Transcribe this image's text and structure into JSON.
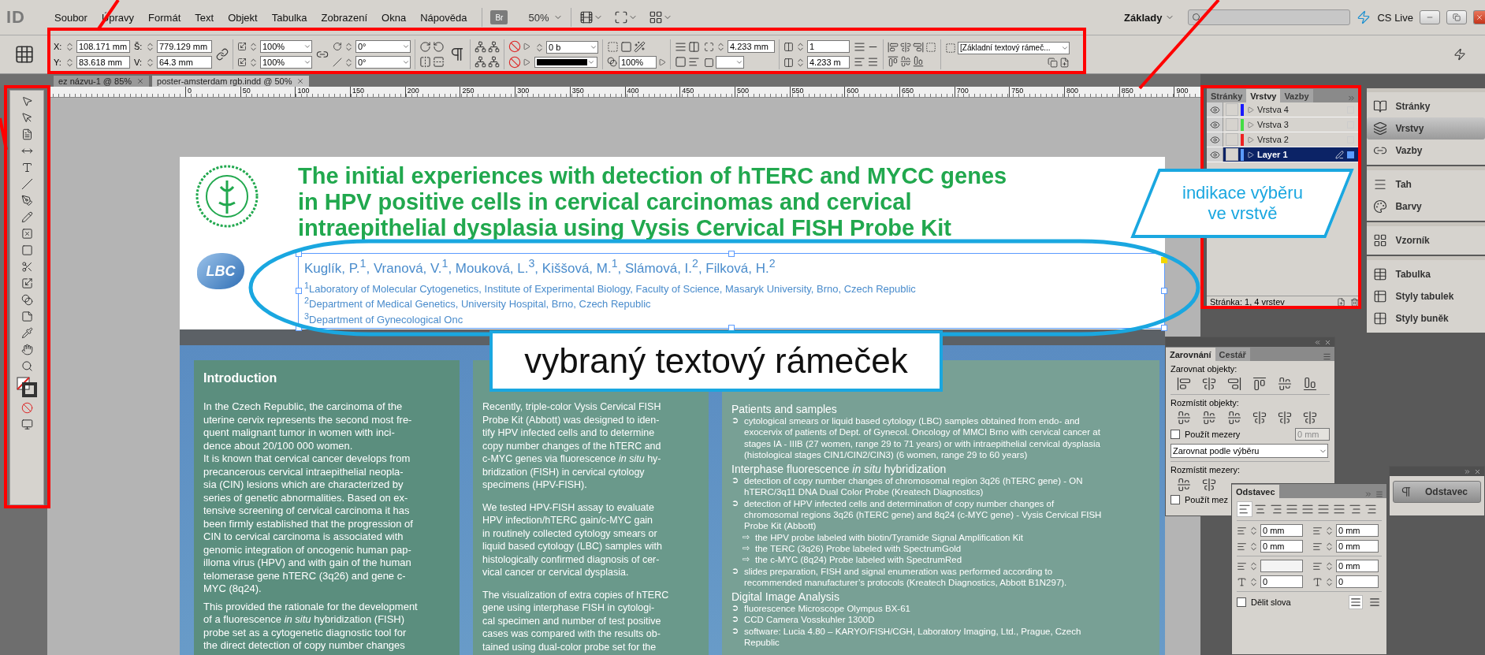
{
  "menu_bar": {
    "app_logo": "ID",
    "items": [
      "Soubor",
      "Úpravy",
      "Formát",
      "Text",
      "Objekt",
      "Tabulka",
      "Zobrazení",
      "Okna",
      "Nápověda"
    ],
    "bridge_button": "Br",
    "zoom": "50%",
    "workspace": "Základy",
    "cs_live": "CS Live"
  },
  "control_panel": {
    "position_fields": [
      {
        "label": "X:",
        "value": "108.171 mm"
      },
      {
        "label": "Y:",
        "value": "83.618 mm"
      }
    ],
    "size_fields": [
      {
        "label": "Š:",
        "value": "779.129 mm"
      },
      {
        "label": "V:",
        "value": "64.3 mm"
      }
    ],
    "scale": [
      "100%",
      "100%"
    ],
    "angles": [
      "0°",
      "0°"
    ],
    "stroke_weight": "0 b",
    "opacity": "100%",
    "inset": "4.233 mm",
    "columns": "1",
    "gutter": "4.233 m",
    "object_style": "[Základní textový rámeč..."
  },
  "document_tabs": [
    {
      "label": "ez názvu-1 @ 85%",
      "selected": false
    },
    {
      "label": "poster-amsterdam rgb.indd @ 50%",
      "selected": true
    }
  ],
  "ruler": [
    "0",
    "50",
    "100",
    "150",
    "200",
    "250",
    "300",
    "350",
    "400",
    "450",
    "500",
    "550",
    "600",
    "650",
    "700",
    "750",
    "800",
    "850",
    "900"
  ],
  "poster": {
    "logo_text": "LBC",
    "title": "The initial experiences with detection of hTERC and MYCC genes\nin HPV positive cells in cervical carcinomas and cervical\nintraepithelial dysplasia using Vysis Cervical FISH Probe Kit",
    "authors": "Kuglík, P.$^{1}$, Vranová, V.$^{1}$, Mouková, L.$^{3}$, Kiššová, M.$^{1}$, Slámová, I.$^{2}$, Filková, H.$^{2}$",
    "affiliations": [
      "$^{1}$Laboratory of Molecular Cytogenetics, Institute of Experimental Biology, Faculty of Science, Masaryk University, Brno, Czech Republic",
      "$^{2}$Department of Medical Genetics, University Hospital, Brno, Czech Republic",
      "$^{3}$Department of Gynecological Onc"
    ],
    "introduction": {
      "heading": "Introduction",
      "paragraphs": [
        "In the Czech Republic, the carcinoma of the\nuterine cervix represents the second most fre-\nquent malignant tumor in women with inci-\ndence about 20/100 000 women.\nIt is known that cervical cancer develops from\nprecancerous cervical intraepithelial neopla-\nsia (CIN) lesions which are characterized by\nseries of genetic abnormalities. Based on ex-\ntensive screening of cervical carcinoma it has\nbeen firmly established that the progression of\nCIN to cervical carcinoma is associated with\ngenomic integration of oncogenic human pap-\nilloma virus (HPV) and with gain of the human\ntelomerase gene hTERC (3q26) and gene c-\nMYC (8q24).",
        "This provided the rationale for the development\nof a fluorescence *in situ* hybridization (FISH)\nprobe set as a cytogenetic diagnostic tool for\nthe direct detection of copy number changes"
      ]
    },
    "aims": {
      "paragraphs": [
        "Recently, triple-color Vysis Cervical FISH\nProbe Kit (Abbott) was designed to iden-\ntify HPV infected cells and to determine\ncopy number changes of the hTERC and\nc-MYC genes via fluorescence *in situ* hy-\nbridization (FISH) in cervical cytology\nspecimens (HPV-FISH).",
        "We tested HPV-FISH assay to evaluate\nHPV infection/hTERC gain/c-MYC gain\nin routinely collected cytology smears or\nliquid based cytology (LBC) samples with\nhistologically confirmed diagnosis of cer-\nvical cancer or cervical dysplasia.",
        "The visualization of extra copies of hTERC\ngene using interphase FISH in cytologi-\ncal specimen and number of test positive\ncases was compared with the results ob-\ntained using dual-color probe set for the"
      ]
    },
    "methods": {
      "sections": [
        {
          "title": "Patients and samples",
          "items": [
            {
              "kind": "main",
              "marker": "➲",
              "text": "cytological smears or liquid based cytology (LBC) samples obtained from endo- and\nexocervix of patients of Dept. of Gynecol. Oncology of MMCI Brno with cervical cancer at\nstages IA - IIIB (27 women, range 29 to 71 years) or with intraepithelial cervical dysplasia\n(histological stages CIN1/CIN2/CIN3) (6 women, range 29 to 60 years)"
            }
          ]
        },
        {
          "title": "Interphase fluorescence *in situ* hybridization",
          "items": [
            {
              "kind": "main",
              "marker": "➲",
              "text": "detection of copy number changes of chromosomal region 3q26 (hTERC gene) - ON\nhTERC/3q11 DNA Dual Color Probe (Kreatech Diagnostics)"
            },
            {
              "kind": "main",
              "marker": "➲",
              "text": "detection of HPV infected cells and determination of copy number changes of\nchromosomal regions 3q26 (hTERC gene) and 8q24 (c-MYC gene) - Vysis Cervical FISH\nProbe Kit (Abbott)"
            },
            {
              "kind": "sub",
              "marker": "⇨",
              "text": "the HPV probe labeled with biotin/Tyramide Signal Amplification Kit"
            },
            {
              "kind": "sub",
              "marker": "⇨",
              "text": "the TERC (3q26) Probe labeled with SpectrumGold"
            },
            {
              "kind": "sub",
              "marker": "⇨",
              "text": "the c-MYC (8q24) Probe labeled with SpectrumRed"
            },
            {
              "kind": "main",
              "marker": "➲",
              "text": "slides preparation, FISH and signal enumeration was performed according to\nrecommended manufacturer’s protocols (Kreatech Diagnostics, Abbott B1N297)."
            }
          ]
        },
        {
          "title": "Digital Image Analysis",
          "items": [
            {
              "kind": "main",
              "marker": "➲",
              "text": "fluorescence Microscope Olympus BX-61"
            },
            {
              "kind": "main",
              "marker": "➲",
              "text": "CCD Camera Vosskuhler 1300D"
            },
            {
              "kind": "main",
              "marker": "➲",
              "text": "software: Lucia 4.80 – KARYO/FISH/CGH, Laboratory Imaging, Ltd., Prague, Czech\nRepublic"
            }
          ]
        }
      ]
    }
  },
  "layers_panel": {
    "tabs": [
      {
        "label": "Stránky",
        "selected": false
      },
      {
        "label": "Vrstvy",
        "selected": true
      },
      {
        "label": "Vazby",
        "selected": false
      }
    ],
    "layers": [
      {
        "name": "Vrstva 4",
        "color": "#1a1aff",
        "selected": false
      },
      {
        "name": "Vrstva 3",
        "color": "#44dd44",
        "selected": false
      },
      {
        "name": "Vrstva 2",
        "color": "#ee2222",
        "selected": false
      },
      {
        "name": "Layer 1",
        "color": "#5b9bff",
        "selected": true
      }
    ],
    "footer": "Stránka: 1, 4 vrstev"
  },
  "dock": [
    [
      {
        "label": "Stránky",
        "selected": false
      },
      {
        "label": "Vrstvy",
        "selected": true
      },
      {
        "label": "Vazby",
        "selected": false
      }
    ],
    [
      {
        "label": "Tah",
        "selected": false
      },
      {
        "label": "Barvy",
        "selected": false
      }
    ],
    [
      {
        "label": "Vzorník",
        "selected": false
      }
    ],
    [
      {
        "label": "Tabulka",
        "selected": false
      },
      {
        "label": "Styly tabulek",
        "selected": false
      },
      {
        "label": "Styly buněk",
        "selected": false
      }
    ]
  ],
  "align_panel": {
    "tabs": [
      {
        "label": "Zarovnání",
        "selected": true
      },
      {
        "label": "Cestář",
        "selected": false
      }
    ],
    "align_label": "Zarovnat objekty:",
    "distribute_label": "Rozmístit objekty:",
    "use_spacing": {
      "label": "Použít mezery",
      "checked": false
    },
    "spacing_value": {
      "value": "0 mm",
      "disabled": true
    },
    "align_to": "Zarovnat podle výběru",
    "spacing_label": "Rozmístit mezery:",
    "use_spacing_2": {
      "label": "Použít mez",
      "checked": false
    }
  },
  "paragraph_panel": {
    "title": "Odstavec",
    "alignments": [
      {
        "selected": true
      },
      {
        "selected": false
      },
      {
        "selected": false
      },
      {
        "selected": false
      },
      {
        "selected": false
      },
      {
        "selected": false
      },
      {
        "selected": false
      },
      {
        "selected": false
      },
      {
        "selected": false
      }
    ],
    "indents": [
      "0 mm",
      "0 mm",
      "0 mm",
      "0 mm"
    ],
    "space_after": "0 mm",
    "drop_caps": [
      "0",
      "0"
    ],
    "hyphenate": {
      "label": "Dělit slova",
      "checked": false
    },
    "composers": [
      {
        "selected": true
      },
      {
        "selected": false
      }
    ]
  },
  "paragraph_mini": {
    "label": "Odstavec"
  },
  "callouts": {
    "frame": "vybraný textový rámeček",
    "layer": "indikace výběru\nve vrstvě"
  }
}
